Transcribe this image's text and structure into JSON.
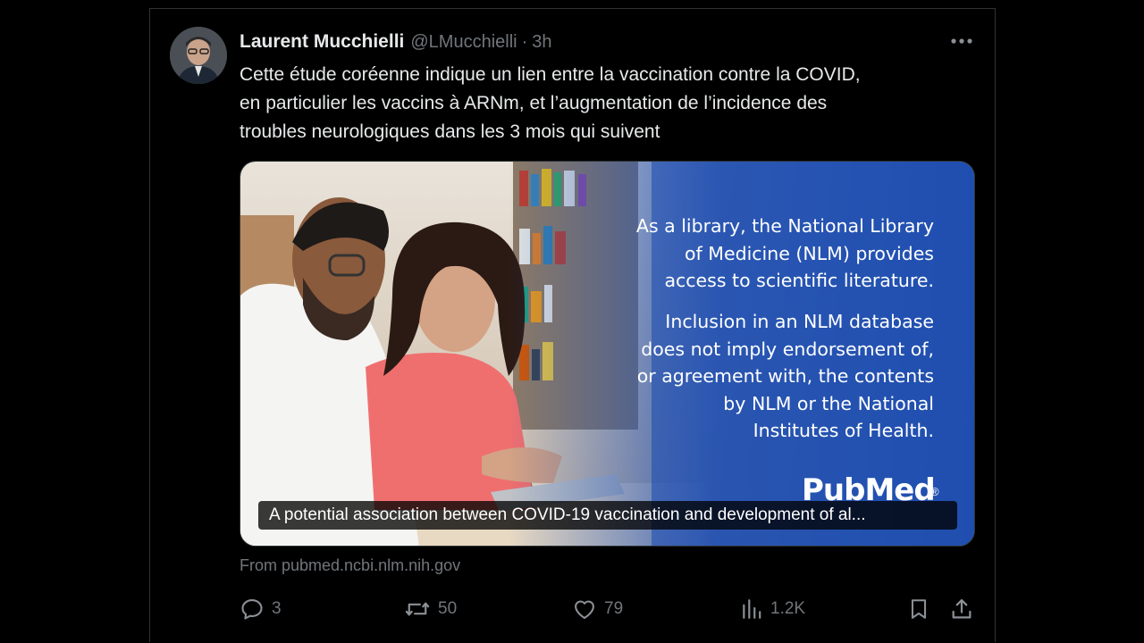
{
  "tweet": {
    "author_name": "Laurent Mucchielli",
    "author_handle": "@LMucchielli",
    "separator": "·",
    "timestamp": "3h",
    "text_lines": [
      "Cette étude coréenne indique un lien entre la vaccination contre la COVID,",
      "en particulier les vaccins à ARNm, et l’augmentation de l’incidence des",
      "troubles neurologiques dans les 3 mois qui suivent"
    ]
  },
  "card": {
    "banner_text_1": [
      "As a library, the National Library",
      "of Medicine (NLM) provides",
      "access to scientific literature."
    ],
    "banner_text_2": [
      "Inclusion in an NLM database",
      "does not imply endorsement of,",
      "or agreement with, the contents",
      "by NLM or the National",
      "Institutes of Health."
    ],
    "logo_text": "PubMed",
    "logo_reg": "®",
    "caption": "A potential association between COVID-19 vaccination and development of al...",
    "source": "From pubmed.ncbi.nlm.nih.gov"
  },
  "actions": {
    "reply_count": "3",
    "repost_count": "50",
    "like_count": "79",
    "views_count": "1.2K"
  },
  "icons": {
    "more": "more-icon",
    "reply": "reply-icon",
    "repost": "repost-icon",
    "like": "heart-icon",
    "views": "views-icon",
    "bookmark": "bookmark-icon",
    "share": "share-icon"
  },
  "colors": {
    "background": "#000000",
    "text": "#e7e9ea",
    "muted": "#71767b",
    "banner_blue": "#1f4fb0"
  }
}
